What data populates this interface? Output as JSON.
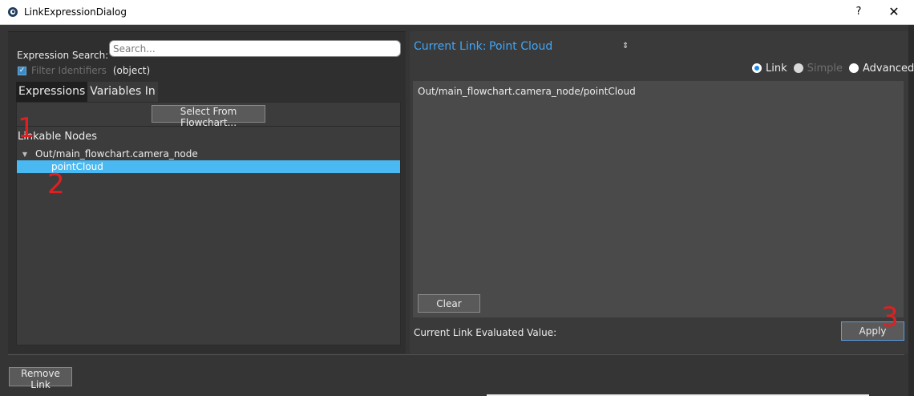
{
  "window": {
    "title": "LinkExpressionDialog",
    "help_label": "?",
    "close_label": "✕"
  },
  "left": {
    "search_label": "Expression Search:",
    "search_placeholder": "Search...",
    "filter_label": "Filter Identifiers",
    "filter_checked": true,
    "filter_type": "(object)",
    "tabs": [
      {
        "label": "Expressions",
        "active": true
      },
      {
        "label": "Variables In",
        "active": false
      }
    ],
    "select_button": "Select From Flowchart...",
    "linkable_title": "Linkable Nodes",
    "tree": {
      "parent": "Out/main_flowchart.camera_node",
      "child": "pointCloud"
    }
  },
  "right": {
    "current_link_label": "Current Link:",
    "current_link_value": "Point Cloud",
    "current_link_arrow": "⇕",
    "modes": [
      {
        "label": "Link",
        "selected": true,
        "enabled": true
      },
      {
        "label": "Simple",
        "selected": false,
        "enabled": false
      },
      {
        "label": "Advanced",
        "selected": false,
        "enabled": true
      }
    ],
    "expression": "Out/main_flowchart.camera_node/pointCloud",
    "clear_button": "Clear",
    "evaluated_label": "Current Link Evaluated Value:",
    "apply_button": "Apply"
  },
  "footer": {
    "remove_button": "Remove Link"
  },
  "markers": [
    "1",
    "2",
    "3"
  ],
  "colors": {
    "accent": "#42a5f5",
    "selection": "#4ab9f2",
    "marker": "#e02020",
    "background": "#353535"
  }
}
